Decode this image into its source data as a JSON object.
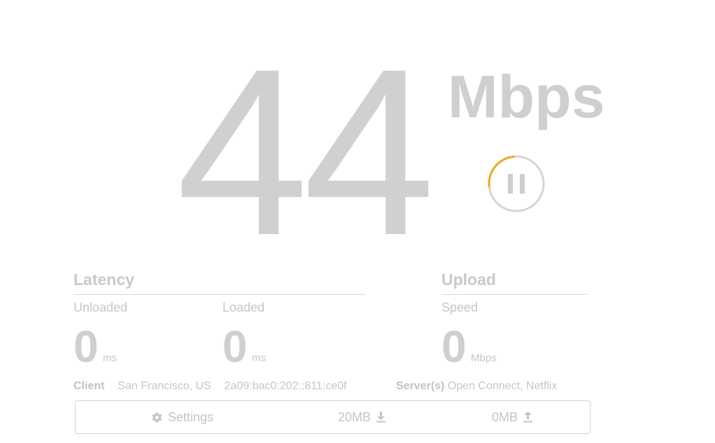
{
  "speed": {
    "value": "44",
    "units": "Mbps"
  },
  "pause_button": {
    "icon": "pause-icon",
    "accent_color": "#f0a81e",
    "progress_fraction": 0.25
  },
  "latency": {
    "title": "Latency",
    "unloaded": {
      "label": "Unloaded",
      "value": "0",
      "unit": "ms"
    },
    "loaded": {
      "label": "Loaded",
      "value": "0",
      "unit": "ms"
    }
  },
  "upload": {
    "title": "Upload",
    "speed": {
      "label": "Speed",
      "value": "0",
      "unit": "Mbps"
    }
  },
  "client": {
    "label": "Client",
    "location": "San Francisco, US",
    "ip": "2a09:bac0:202::811:ce0f"
  },
  "servers": {
    "label": "Server(s)",
    "value": "Open Connect, Netflix"
  },
  "toolbar": {
    "settings_label": "Settings",
    "settings_icon": "gear-icon",
    "download_label": "20MB",
    "download_icon": "download-icon",
    "upload_label": "0MB",
    "upload_icon": "upload-icon"
  }
}
